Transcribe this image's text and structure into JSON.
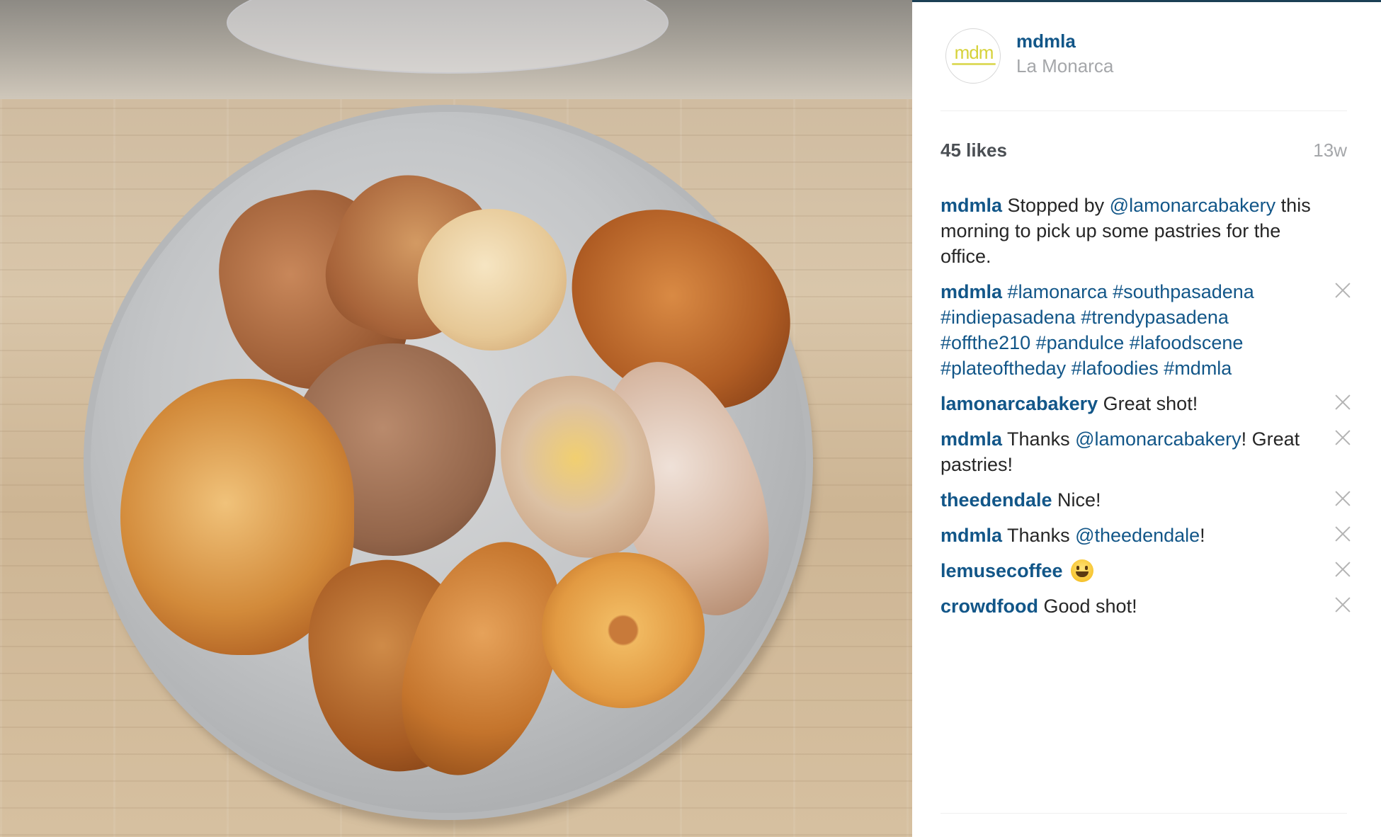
{
  "post": {
    "username": "mdmla",
    "location": "La Monarca",
    "avatar_text": "mdm",
    "likes": "45 likes",
    "time": "13w"
  },
  "comments": [
    {
      "author": "mdmla",
      "parts": [
        {
          "t": " Stopped by "
        },
        {
          "m": "@lamonarcabakery"
        },
        {
          "t": " this morning to pick up some pastries for the office."
        }
      ],
      "closable": false
    },
    {
      "author": "mdmla",
      "parts": [
        {
          "t": " "
        },
        {
          "h": "#lamonarca"
        },
        {
          "t": " "
        },
        {
          "h": "#southpasadena"
        },
        {
          "t": " "
        },
        {
          "h": "#indiepasadena"
        },
        {
          "t": " "
        },
        {
          "h": "#trendypasadena"
        },
        {
          "t": " "
        },
        {
          "h": "#offthe210"
        },
        {
          "t": " "
        },
        {
          "h": "#pandulce"
        },
        {
          "t": " "
        },
        {
          "h": "#lafoodscene"
        },
        {
          "t": " "
        },
        {
          "h": "#plateoftheday"
        },
        {
          "t": " "
        },
        {
          "h": "#lafoodies"
        },
        {
          "t": " "
        },
        {
          "h": "#mdmla"
        }
      ],
      "closable": true
    },
    {
      "author": "lamonarcabakery",
      "parts": [
        {
          "t": " Great shot!"
        }
      ],
      "closable": true
    },
    {
      "author": "mdmla",
      "parts": [
        {
          "t": " Thanks "
        },
        {
          "m": "@lamonarcabakery"
        },
        {
          "t": "! Great pastries!"
        }
      ],
      "closable": true
    },
    {
      "author": "theedendale",
      "parts": [
        {
          "t": " Nice!"
        }
      ],
      "closable": true
    },
    {
      "author": "mdmla",
      "parts": [
        {
          "t": " Thanks "
        },
        {
          "m": "@theedendale"
        },
        {
          "t": "!"
        }
      ],
      "closable": true
    },
    {
      "author": "lemusecoffee",
      "parts": [
        {
          "t": " "
        },
        {
          "e": "smiley-emoji"
        }
      ],
      "closable": true
    },
    {
      "author": "crowdfood",
      "parts": [
        {
          "t": " Good shot!"
        }
      ],
      "closable": true
    }
  ],
  "colors": {
    "link": "#125688",
    "muted": "#a5a7aa",
    "accent_bar": "#1b3f55"
  },
  "icons": {
    "delete": "close-icon",
    "emoji": "smiley-emoji"
  }
}
